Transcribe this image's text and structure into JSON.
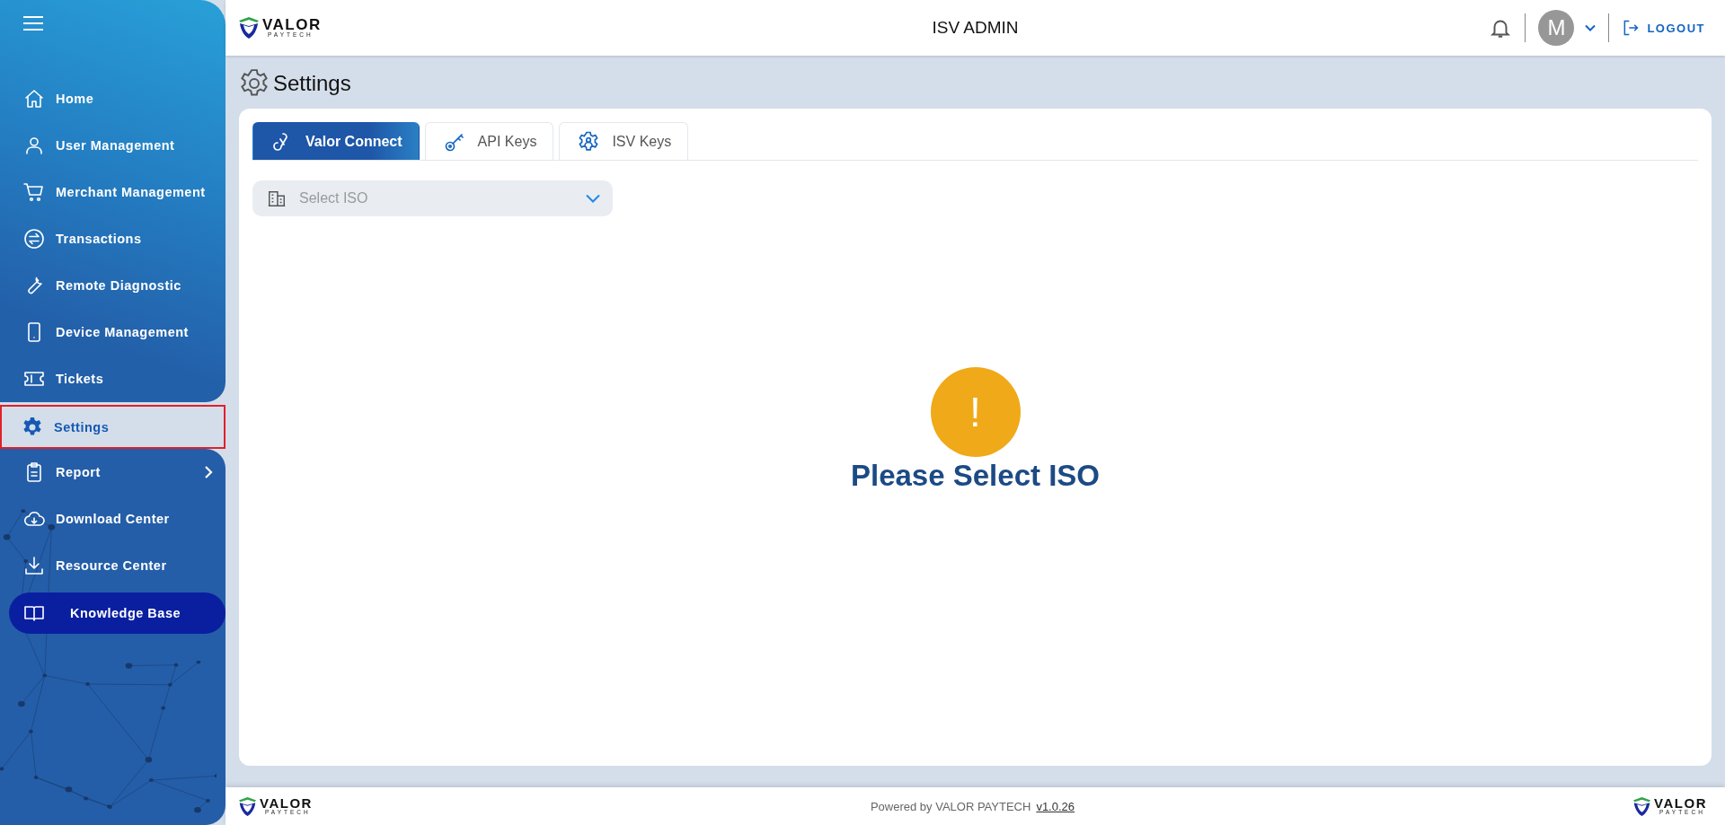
{
  "sidebar": {
    "items": [
      {
        "label": "Home",
        "kind": "nav",
        "selected": false
      },
      {
        "label": "User Management",
        "kind": "nav",
        "selected": false
      },
      {
        "label": "Merchant Management",
        "kind": "nav",
        "selected": false
      },
      {
        "label": "Transactions",
        "kind": "nav",
        "selected": false
      },
      {
        "label": "Remote Diagnostic",
        "kind": "nav",
        "selected": false
      },
      {
        "label": "Device Management",
        "kind": "nav",
        "selected": false
      },
      {
        "label": "Tickets",
        "kind": "nav",
        "selected": false
      },
      {
        "label": "Settings",
        "kind": "nav",
        "selected": true
      },
      {
        "label": "Report",
        "kind": "expandable",
        "selected": false
      },
      {
        "label": "Download Center",
        "kind": "nav",
        "selected": false
      },
      {
        "label": "Resource Center",
        "kind": "nav",
        "selected": false
      },
      {
        "label": "Knowledge Base",
        "kind": "featured",
        "selected": false
      }
    ]
  },
  "header": {
    "logo": {
      "name": "VALOR",
      "sub": "PAYTECH"
    },
    "title": "ISV ADMIN",
    "avatar": "M",
    "logout": "LOGOUT"
  },
  "page": {
    "title": "Settings",
    "tabs": [
      {
        "label": "Valor Connect",
        "selected": true
      },
      {
        "label": "API Keys",
        "selected": false
      },
      {
        "label": "ISV Keys",
        "selected": false
      }
    ],
    "select": {
      "placeholder": "Select ISO"
    },
    "notice": {
      "icon": "!",
      "message": "Please Select ISO"
    }
  },
  "footer": {
    "logo_left": {
      "name": "VALOR",
      "sub": "PAYTECH"
    },
    "text": "Powered by VALOR PAYTECH",
    "version": "v1.0.26",
    "logo_right": {
      "name": "VALOR",
      "sub": "PAYTECH"
    }
  }
}
